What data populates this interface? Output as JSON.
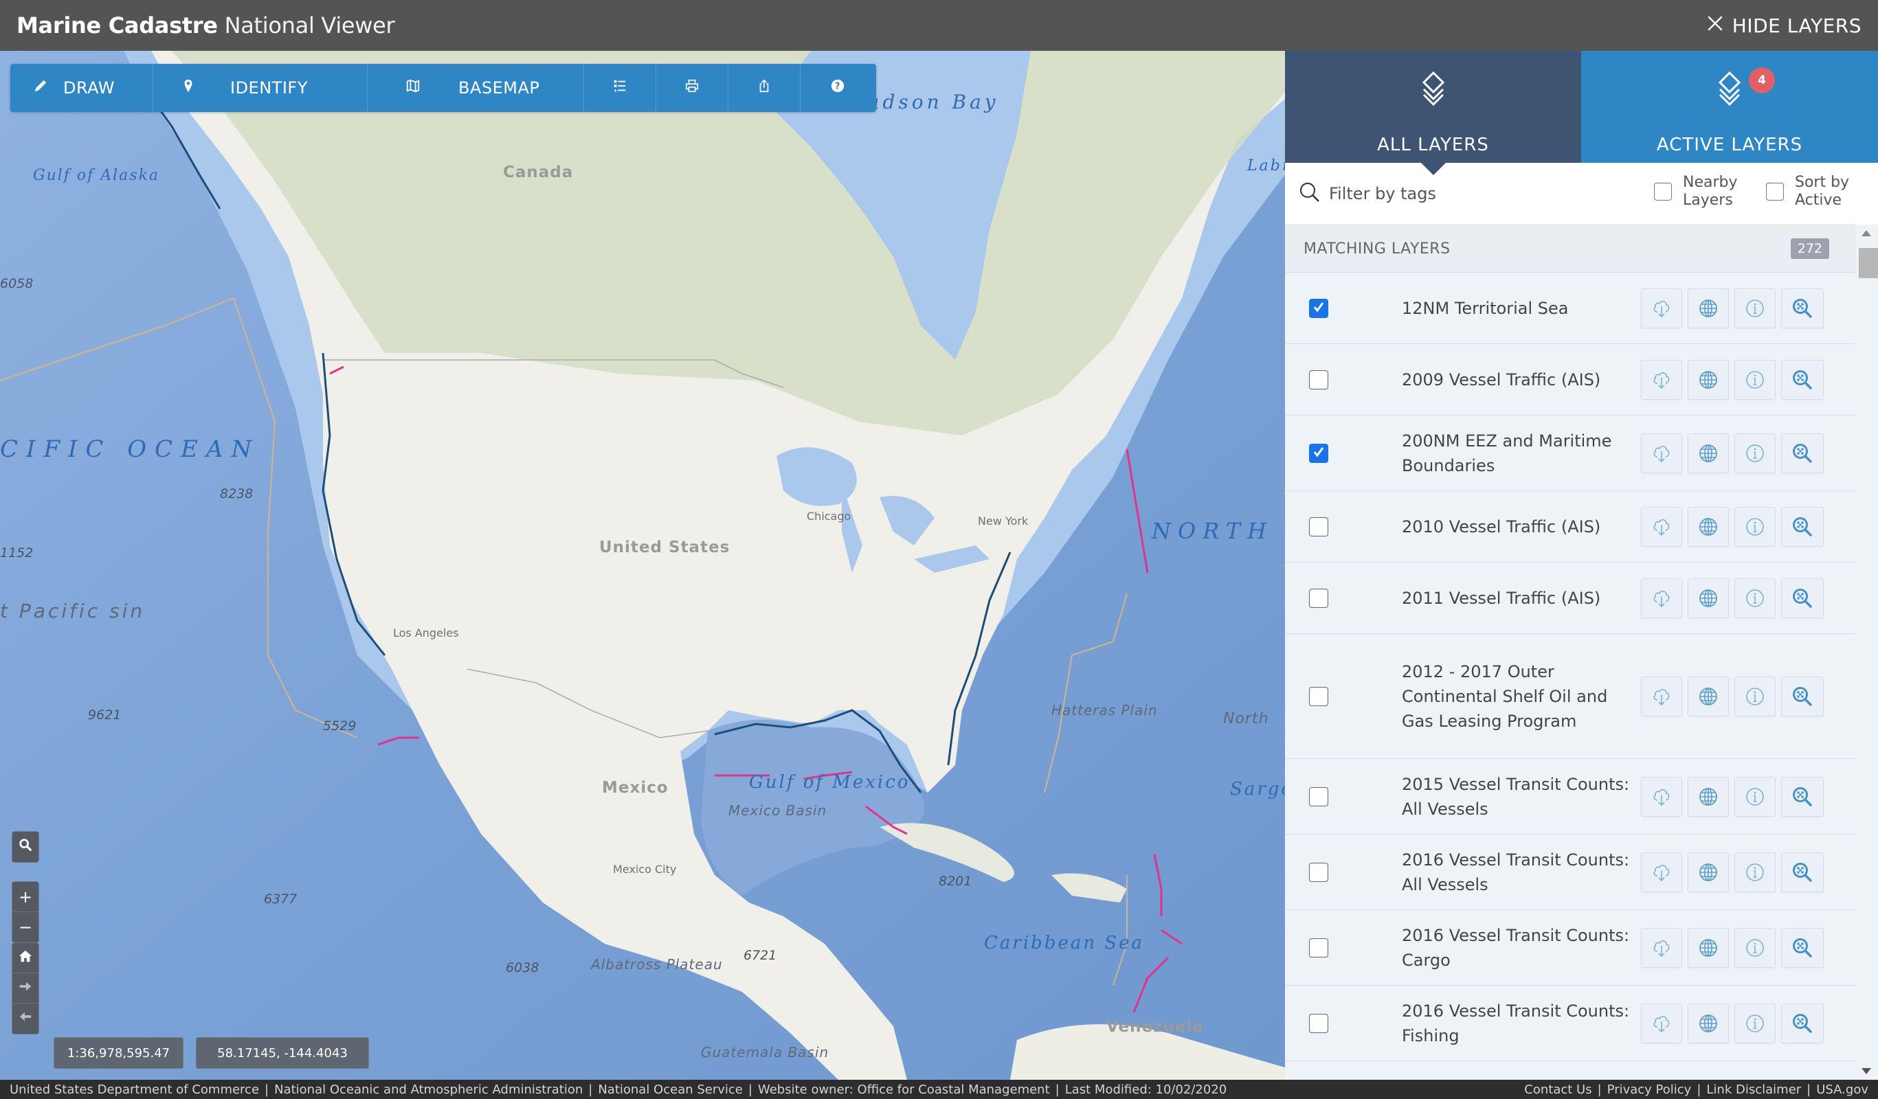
{
  "header": {
    "title_bold": "Marine Cadastre",
    "title_light": "National Viewer",
    "hide_layers_label": "HIDE LAYERS"
  },
  "toolbar": {
    "draw_label": "DRAW",
    "identify_label": "IDENTIFY",
    "basemap_label": "BASEMAP",
    "icons": [
      "legend-icon",
      "print-icon",
      "share-icon",
      "help-icon"
    ]
  },
  "map": {
    "labels": {
      "gulf_of_alaska": "Gulf of Alaska",
      "canada": "Canada",
      "hudson_bay": "Hudson Bay",
      "labrador_sea": "Labr S",
      "pacific_ocean": "CIFIC OCEAN",
      "united_states": "United States",
      "chicago": "Chicago",
      "new_york": "New York",
      "north_atlantic": "NORTH",
      "los_angeles": "Los Angeles",
      "pacific_basin": "t Pacific sin",
      "mexico": "Mexico",
      "gulf_of_mexico": "Gulf of Mexico",
      "mexico_basin": "Mexico Basin",
      "mexico_city": "Mexico City",
      "hatteras_plain": "Hatteras Plain",
      "north_feature": "North",
      "sargasso": "Sargo",
      "caribbean_sea": "Caribbean Sea",
      "albatross_plateau": "Albatross Plateau",
      "guatemala_basin": "Guatemala Basin",
      "venezuela": "Venezuela",
      "depth_6058": "6058",
      "depth_8238": "8238",
      "depth_1152": "1152",
      "depth_9621": "9621",
      "depth_5529": "5529",
      "depth_6377": "6377",
      "depth_6038": "6038",
      "depth_6721": "6721",
      "depth_8201": "8201"
    },
    "scale": "1:36,978,595.47",
    "coordinates": "58.17145, -144.4043"
  },
  "panel": {
    "tabs": [
      {
        "label": "ALL LAYERS",
        "selected": true
      },
      {
        "label": "ACTIVE LAYERS",
        "badge": "4"
      }
    ],
    "filter": {
      "placeholder": "Filter by tags",
      "value": "",
      "nearby_label_1": "Nearby",
      "nearby_label_2": "Layers",
      "nearby_checked": false,
      "sort_label_1": "Sort by",
      "sort_label_2": "Active",
      "sort_checked": false
    },
    "matching_label": "MATCHING LAYERS",
    "matching_count": "272",
    "layers": [
      {
        "name": "12NM Territorial Sea",
        "checked": true
      },
      {
        "name": "2009 Vessel Traffic (AIS)",
        "checked": false
      },
      {
        "name": "200NM EEZ and Maritime Boundaries",
        "checked": true
      },
      {
        "name": "2010 Vessel Traffic (AIS)",
        "checked": false
      },
      {
        "name": "2011 Vessel Traffic (AIS)",
        "checked": false
      },
      {
        "name": "2012 - 2017 Outer Continental Shelf Oil and Gas Leasing Program",
        "checked": false
      },
      {
        "name": "2015 Vessel Transit Counts: All Vessels",
        "checked": false
      },
      {
        "name": "2016 Vessel Transit Counts: All Vessels",
        "checked": false
      },
      {
        "name": "2016 Vessel Transit Counts: Cargo",
        "checked": false
      },
      {
        "name": "2016 Vessel Transit Counts: Fishing",
        "checked": false
      }
    ],
    "row_actions": [
      "download-icon",
      "globe-icon",
      "info-icon",
      "zoom-to-icon"
    ]
  },
  "footer": {
    "left": [
      "United States Department of Commerce",
      "National Oceanic and Atmospheric Administration",
      "National Ocean Service",
      "Website owner: Office for Coastal Management",
      "Last Modified: 10/02/2020"
    ],
    "right": [
      "Contact Us",
      "Privacy Policy",
      "Link Disclaimer",
      "USA.gov"
    ]
  },
  "colors": {
    "header_bg": "#545454",
    "toolbar_blue": "#2f86c4",
    "tab_all_bg": "#3d5572",
    "tab_active_bg": "#2f86c4",
    "badge_red": "#e0606a",
    "checkbox_blue": "#1a73e8",
    "vessel_track_magenta": "#e0338a"
  }
}
